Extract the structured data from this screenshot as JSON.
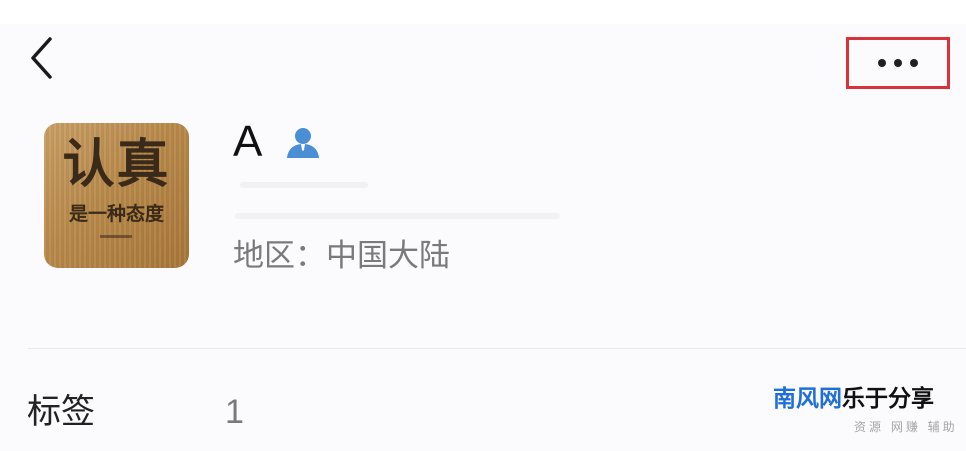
{
  "header": {
    "back_icon": "chevron-left-icon",
    "more_icon": "more-horizontal-icon",
    "highlight_color": "#d8333b"
  },
  "profile": {
    "avatar_text_main": "认真",
    "avatar_text_sub": "是一种态度",
    "name": "A",
    "badge_icon": "person-icon",
    "badge_color": "#4a8fd4",
    "region": "地区：中国大陆"
  },
  "tags": {
    "label": "标签",
    "value": "1"
  },
  "watermark": {
    "title_part_a": "南风网",
    "title_part_b": "乐于分享",
    "subtitle": "资源 网赚 辅助",
    "color_a": "#1e6fd8"
  }
}
